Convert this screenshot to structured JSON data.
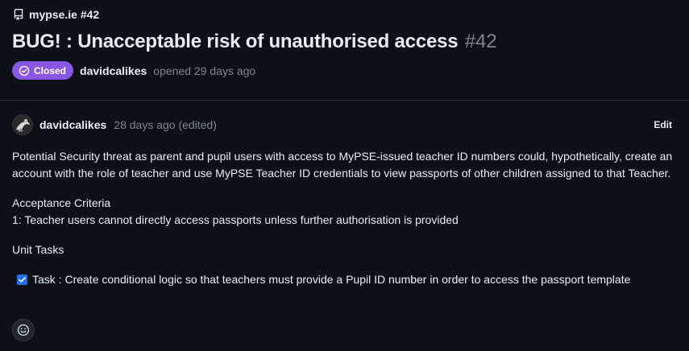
{
  "header": {
    "repo_icon": "repo-icon",
    "repo_label": "mypse.ie #42",
    "title": "BUG! : Unacceptable risk of unauthorised access",
    "number": "#42",
    "status_icon": "issue-closed-icon",
    "status": "Closed",
    "status_color": "#8957e5",
    "author": "davidcalikes",
    "opened_text": "opened 29 days ago"
  },
  "comment": {
    "author": "davidcalikes",
    "time": "28 days ago (edited)",
    "edit_label": "Edit",
    "paragraph1": "Potential Security threat as parent and pupil users with access to MyPSE-issued teacher ID numbers could, hypothetically, create an account with the role of teacher and use MyPSE Teacher ID credentials to view passports of other children assigned to that Teacher.",
    "criteria_title": "Acceptance Criteria",
    "criteria_item": "1: Teacher users cannot directly access passports unless further authorisation is provided",
    "unit_tasks_title": "Unit Tasks",
    "task_text": "Task : Create conditional logic so that teachers must provide a Pupil ID number in order to access the passport template",
    "task_checked": true,
    "reaction_icon": "smiley-icon"
  }
}
